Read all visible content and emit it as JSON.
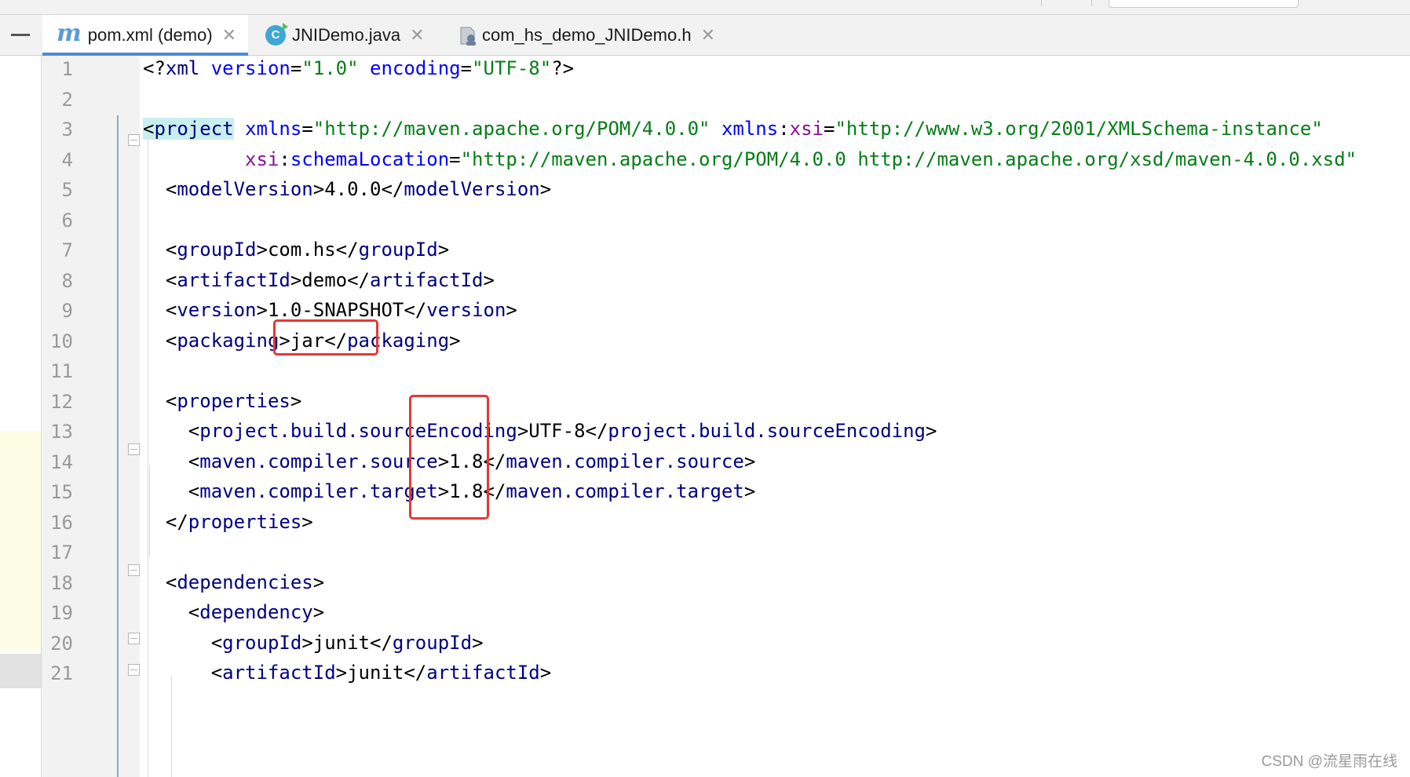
{
  "tabs": [
    {
      "label": "pom.xml (demo)",
      "icon": "maven-file-icon",
      "active": true
    },
    {
      "label": "JNIDemo.java",
      "icon": "java-class-icon",
      "active": false
    },
    {
      "label": "com_hs_demo_JNIDemo.h",
      "icon": "c-header-file-icon",
      "active": false
    }
  ],
  "editor": {
    "line_numbers": [
      "1",
      "2",
      "3",
      "4",
      "5",
      "6",
      "7",
      "8",
      "9",
      "10",
      "11",
      "12",
      "13",
      "14",
      "15",
      "16",
      "17",
      "18",
      "19",
      "20",
      "21"
    ],
    "lines": [
      [
        {
          "c": "p",
          "t": "<?"
        },
        {
          "c": "t",
          "t": "xml "
        },
        {
          "c": "a",
          "t": "version"
        },
        {
          "c": "p",
          "t": "="
        },
        {
          "c": "v",
          "t": "\"1.0\""
        },
        {
          "c": "p",
          "t": " "
        },
        {
          "c": "a",
          "t": "encoding"
        },
        {
          "c": "p",
          "t": "="
        },
        {
          "c": "v",
          "t": "\"UTF-8\""
        },
        {
          "c": "p",
          "t": "?>"
        }
      ],
      [],
      [
        {
          "c": "hl",
          "t": "<project"
        },
        {
          "c": "p",
          "t": " "
        },
        {
          "c": "a",
          "t": "xmlns"
        },
        {
          "c": "p",
          "t": "="
        },
        {
          "c": "v",
          "t": "\"http://maven.apache.org/POM/4.0.0\""
        },
        {
          "c": "p",
          "t": " "
        },
        {
          "c": "a",
          "t": "xmlns"
        },
        {
          "c": "p",
          "t": ":"
        },
        {
          "c": "ns",
          "t": "xsi"
        },
        {
          "c": "p",
          "t": "="
        },
        {
          "c": "v",
          "t": "\"http://www.w3.org/2001/XMLSchema-instance\""
        }
      ],
      [
        {
          "c": "p",
          "t": "         "
        },
        {
          "c": "ns",
          "t": "xsi"
        },
        {
          "c": "p",
          "t": ":"
        },
        {
          "c": "a",
          "t": "schemaLocation"
        },
        {
          "c": "p",
          "t": "="
        },
        {
          "c": "v",
          "t": "\"http://maven.apache.org/POM/4.0.0 http://maven.apache.org/xsd/maven-4.0.0.xsd\""
        }
      ],
      [
        {
          "c": "p",
          "t": "  <"
        },
        {
          "c": "t",
          "t": "modelVersion"
        },
        {
          "c": "p",
          "t": ">4.0.0</"
        },
        {
          "c": "t",
          "t": "modelVersion"
        },
        {
          "c": "p",
          "t": ">"
        }
      ],
      [],
      [
        {
          "c": "p",
          "t": "  <"
        },
        {
          "c": "t",
          "t": "groupId"
        },
        {
          "c": "p",
          "t": ">com.hs</"
        },
        {
          "c": "t",
          "t": "groupId"
        },
        {
          "c": "p",
          "t": ">"
        }
      ],
      [
        {
          "c": "p",
          "t": "  <"
        },
        {
          "c": "t",
          "t": "artifactId"
        },
        {
          "c": "p",
          "t": ">demo</"
        },
        {
          "c": "t",
          "t": "artifactId"
        },
        {
          "c": "p",
          "t": ">"
        }
      ],
      [
        {
          "c": "p",
          "t": "  <"
        },
        {
          "c": "t",
          "t": "version"
        },
        {
          "c": "p",
          "t": ">1.0-SNAPSHOT</"
        },
        {
          "c": "t",
          "t": "version"
        },
        {
          "c": "p",
          "t": ">"
        }
      ],
      [
        {
          "c": "p",
          "t": "  <"
        },
        {
          "c": "t",
          "t": "packaging"
        },
        {
          "c": "p",
          "t": ">jar</"
        },
        {
          "c": "t",
          "t": "packaging"
        },
        {
          "c": "p",
          "t": ">"
        }
      ],
      [],
      [
        {
          "c": "p",
          "t": "  <"
        },
        {
          "c": "t",
          "t": "properties"
        },
        {
          "c": "p",
          "t": ">"
        }
      ],
      [
        {
          "c": "p",
          "t": "    <"
        },
        {
          "c": "t",
          "t": "project.build.sourceEncoding"
        },
        {
          "c": "p",
          "t": ">UTF-8</"
        },
        {
          "c": "t",
          "t": "project.build.sourceEncoding"
        },
        {
          "c": "p",
          "t": ">"
        }
      ],
      [
        {
          "c": "p",
          "t": "    <"
        },
        {
          "c": "t",
          "t": "maven.compiler.source"
        },
        {
          "c": "p",
          "t": ">1.8</"
        },
        {
          "c": "t",
          "t": "maven.compiler.source"
        },
        {
          "c": "p",
          "t": ">"
        }
      ],
      [
        {
          "c": "p",
          "t": "    <"
        },
        {
          "c": "t",
          "t": "maven.compiler.target"
        },
        {
          "c": "p",
          "t": ">1.8</"
        },
        {
          "c": "t",
          "t": "maven.compiler.target"
        },
        {
          "c": "p",
          "t": ">"
        }
      ],
      [
        {
          "c": "p",
          "t": "  </"
        },
        {
          "c": "t",
          "t": "properties"
        },
        {
          "c": "p",
          "t": ">"
        }
      ],
      [],
      [
        {
          "c": "p",
          "t": "  <"
        },
        {
          "c": "t",
          "t": "dependencies"
        },
        {
          "c": "p",
          "t": ">"
        }
      ],
      [
        {
          "c": "p",
          "t": "    <"
        },
        {
          "c": "t",
          "t": "dependency"
        },
        {
          "c": "p",
          "t": ">"
        }
      ],
      [
        {
          "c": "p",
          "t": "      <"
        },
        {
          "c": "t",
          "t": "groupId"
        },
        {
          "c": "p",
          "t": ">junit</"
        },
        {
          "c": "t",
          "t": "groupId"
        },
        {
          "c": "p",
          "t": ">"
        }
      ],
      [
        {
          "c": "p",
          "t": "      <"
        },
        {
          "c": "t",
          "t": "artifactId"
        },
        {
          "c": "p",
          "t": ">junit</"
        },
        {
          "c": "t",
          "t": "artifactId"
        },
        {
          "c": "p",
          "t": ">"
        }
      ]
    ]
  },
  "watermark": "CSDN @流星雨在线",
  "colors": {
    "tag": "#000080",
    "attribute": "#0000ff",
    "value": "#067d17",
    "namespace": "#871094",
    "callout": "#e53935",
    "active_tab_underline": "#4c8ad5"
  }
}
